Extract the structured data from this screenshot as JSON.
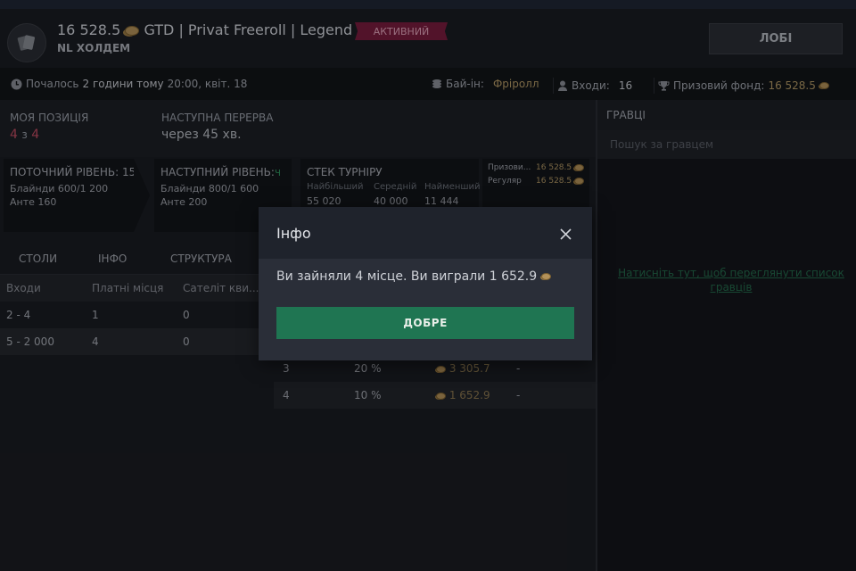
{
  "header": {
    "prize_amount": "16 528.5",
    "title_rest": "GTD | Privat Freeroll | Legend",
    "game_type": "NL ХОЛДЕМ",
    "status_badge": "АКТИВНИЙ",
    "lobby_label": "ЛОБІ"
  },
  "infobar": {
    "started_label": "Почалось",
    "started_ago": "2 години тому",
    "started_time": "20:00, квіт. 18",
    "buyin_label": "Бай-ін:",
    "buyin_value": "Фріролл",
    "entries_label": "Входи:",
    "entries_value": "16",
    "prizepool_label": "Призовий фонд:",
    "prizepool_value": "16 528.5"
  },
  "position": {
    "my_position_label": "МОЯ ПОЗИЦІЯ",
    "my_position_place": "4",
    "my_position_of": "з",
    "my_position_total": "4",
    "next_break_label": "НАСТУПНА ПЕРЕРВА",
    "next_break_value": "через 45 хв."
  },
  "levels": {
    "current_label": "ПОТОЧНИЙ РІВЕНЬ: 15",
    "current_blinds": "Блайнди 600/1 200",
    "current_ante": "Анте 160",
    "next_label": "НАСТУПНИЙ РІВЕНЬ:",
    "next_label_suffix": "ч",
    "next_blinds": "Блайнди 800/1 600",
    "next_ante": "Анте 200"
  },
  "stack": {
    "title": "СТЕК ТУРНІРУ",
    "largest_label": "Найбільший",
    "average_label": "Середній",
    "smallest_label": "Найменший",
    "largest_value": "55 020",
    "average_value": "40 000",
    "smallest_value": "11 444"
  },
  "prize_mini": {
    "row1_label": "Призови...",
    "row1_value": "16 528.5",
    "row2_label": "Регуляр",
    "row2_value": "16 528.5"
  },
  "tabs": [
    "СТОЛИ",
    "ІНФО",
    "СТРУКТУРА"
  ],
  "entries_table": {
    "headers": [
      "Входи",
      "Платні місця",
      "Сателіт кви..."
    ],
    "rows": [
      [
        "2 - 4",
        "1",
        "0"
      ],
      [
        "5 - 2 000",
        "4",
        "0"
      ]
    ]
  },
  "prize_table": {
    "rows": [
      {
        "place": "3",
        "percent": "20 %",
        "amount": "3 305.7",
        "extra": "-"
      },
      {
        "place": "4",
        "percent": "10 %",
        "amount": "1 652.9",
        "extra": "-"
      }
    ]
  },
  "players": {
    "title": "ГРАВЦІ",
    "search_placeholder": "Пошук за гравцем",
    "show_link": "Натисніть тут, щоб переглянути список гравців"
  },
  "modal": {
    "title": "Інфо",
    "message": "Ви зайняли 4 місце. Ви виграли 1 652.9",
    "ok_label": "ДОБРЕ"
  },
  "colors": {
    "accent_green": "#1f7552",
    "badge_red": "#7a1d3e",
    "position_red": "#c24d63",
    "coin_gold": "#b4925a"
  },
  "icons": [
    "cards-logo-icon",
    "coin-icon",
    "clock-icon",
    "coins-stack-icon",
    "user-icon",
    "trophy-icon",
    "close-icon"
  ]
}
